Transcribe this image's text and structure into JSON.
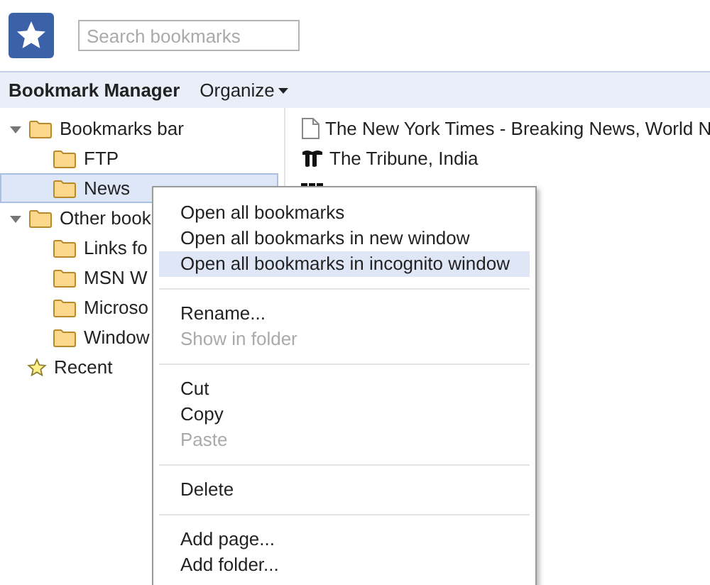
{
  "search": {
    "placeholder": "Search bookmarks"
  },
  "toolbar": {
    "title": "Bookmark Manager",
    "menu": "Organize"
  },
  "tree": [
    {
      "label": "Bookmarks bar",
      "kind": "folder",
      "expanded": true,
      "selected": false,
      "children": [
        {
          "label": "FTP",
          "kind": "folder",
          "selected": false
        },
        {
          "label": "News",
          "kind": "folder",
          "selected": true
        }
      ]
    },
    {
      "label": "Other book",
      "kind": "folder",
      "expanded": true,
      "selected": false,
      "children": [
        {
          "label": "Links fo",
          "kind": "folder",
          "selected": false
        },
        {
          "label": "MSN W",
          "kind": "folder",
          "selected": false
        },
        {
          "label": "Microso",
          "kind": "folder",
          "selected": false
        },
        {
          "label": "Window",
          "kind": "folder",
          "selected": false
        }
      ]
    },
    {
      "label": "Recent",
      "kind": "recent",
      "selected": false
    }
  ],
  "bookmarks": [
    {
      "title": "The New York Times - Breaking News, World N",
      "kind": "page"
    },
    {
      "title": "The Tribune, India",
      "kind": "tribune"
    },
    {
      "kind": "bbc"
    }
  ],
  "context_menu": {
    "groups": [
      [
        {
          "label": "Open all bookmarks",
          "disabled": false,
          "selected": false
        },
        {
          "label": "Open all bookmarks in new window",
          "disabled": false,
          "selected": false
        },
        {
          "label": "Open all bookmarks in incognito window",
          "disabled": false,
          "selected": true
        }
      ],
      [
        {
          "label": "Rename...",
          "disabled": false,
          "selected": false
        },
        {
          "label": "Show in folder",
          "disabled": true,
          "selected": false
        }
      ],
      [
        {
          "label": "Cut",
          "disabled": false,
          "selected": false
        },
        {
          "label": "Copy",
          "disabled": false,
          "selected": false
        },
        {
          "label": "Paste",
          "disabled": true,
          "selected": false
        }
      ],
      [
        {
          "label": "Delete",
          "disabled": false,
          "selected": false
        }
      ],
      [
        {
          "label": "Add page...",
          "disabled": false,
          "selected": false
        },
        {
          "label": "Add folder...",
          "disabled": false,
          "selected": false
        }
      ]
    ]
  }
}
